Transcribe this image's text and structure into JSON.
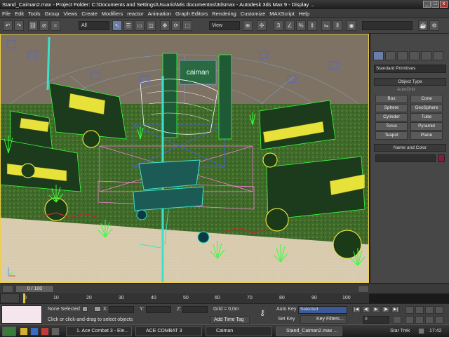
{
  "window": {
    "title": "Stand_Caiman2.max    - Project Folder: C:\\Documents and Settings\\Usuario\\Mis documentos\\3dsmax    - Autodesk 3ds Max 9    - Display ..."
  },
  "menu": [
    "File",
    "Edit",
    "Tools",
    "Group",
    "Views",
    "Create",
    "Modifiers",
    "reactor",
    "Animation",
    "Graph Editors",
    "Rendering",
    "Customize",
    "MAXScript",
    "Help"
  ],
  "toolbar": {
    "selection_filter": "All",
    "reference_coord": "View"
  },
  "viewport": {
    "sign_text": "caiman"
  },
  "command_panel": {
    "category": "Standard Primitives",
    "object_type_title": "Object Type",
    "autogrid_label": "AutoGrid",
    "buttons": [
      "Box",
      "Cone",
      "Sphere",
      "GeoSphere",
      "Cylinder",
      "Tube",
      "Torus",
      "Pyramid",
      "Teapot",
      "Plane"
    ],
    "name_color_title": "Name and Color",
    "name_value": ""
  },
  "timeline": {
    "frame_counter": "0 / 100",
    "ticks": [
      "0",
      "10",
      "20",
      "30",
      "40",
      "50",
      "60",
      "70",
      "80",
      "90",
      "100"
    ]
  },
  "status": {
    "selection": "None Selected",
    "prompt": "Click or click-and-drag to select objects",
    "x_label": "X:",
    "y_label": "Y:",
    "z_label": "Z:",
    "grid": "Grid = 0,0m",
    "add_time_tag": "Add Time Tag",
    "auto_key": "Auto Key",
    "set_key": "Set Key",
    "key_mode": "Selected",
    "key_filters": "Key Filters...",
    "current_frame": "0"
  },
  "taskbar": {
    "tasks": [
      "1. Ace Combat 3 - Ele...",
      "ACE COMBAT 3",
      "Caiman",
      "Stand_Caiman2.max ..."
    ],
    "tray_text": "Star Trek",
    "clock": "17:42"
  },
  "colors": {
    "ground": "#d9ccb0",
    "grass": "#3f6a2a",
    "wire_green": "#36ff3a",
    "wire_cyan": "#3de1c9",
    "wire_pink": "#ff7fe0",
    "wire_blue": "#4060ff",
    "machine_yellow": "#e6e23a"
  }
}
